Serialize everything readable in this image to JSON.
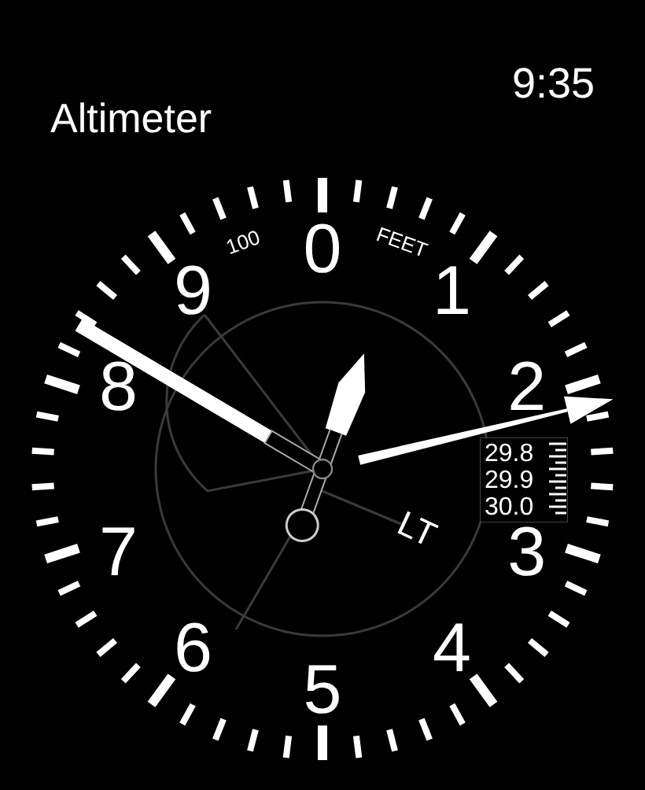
{
  "title": "Altimeter",
  "time": "9:35",
  "dial": {
    "numbers": [
      "0",
      "1",
      "2",
      "3",
      "4",
      "5",
      "6",
      "7",
      "8",
      "9"
    ],
    "scale_label": "100",
    "unit": "FEET",
    "inner_label": "LT",
    "baro_readings": [
      "29.8",
      "29.9",
      "30.0"
    ],
    "hands": [
      {
        "kind": "long"
      },
      {
        "kind": "short"
      },
      {
        "kind": "needle"
      }
    ]
  }
}
